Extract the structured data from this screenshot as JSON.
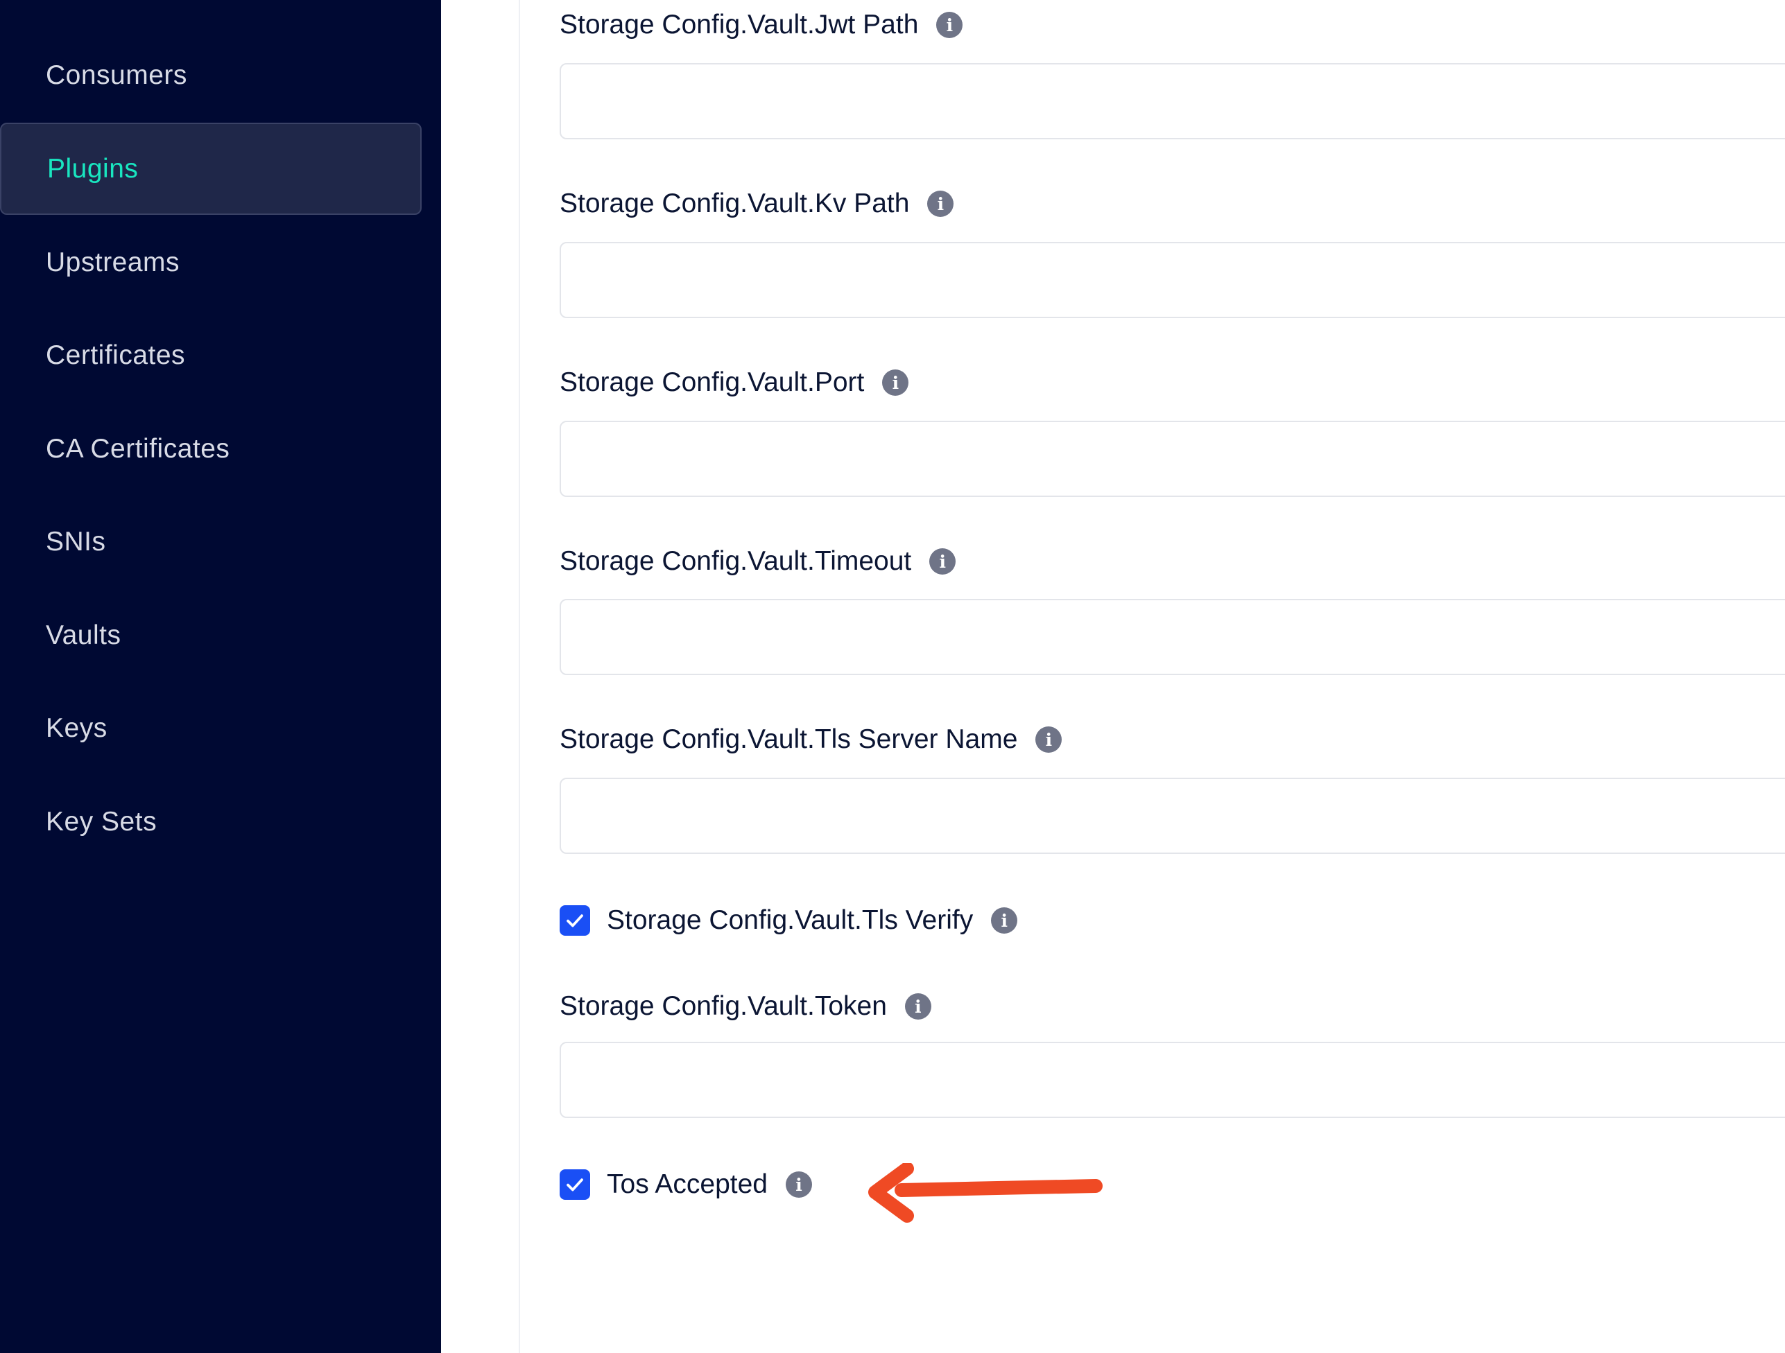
{
  "sidebar": {
    "items": [
      {
        "label": "Consumers",
        "active": false
      },
      {
        "label": "Plugins",
        "active": true
      },
      {
        "label": "Upstreams",
        "active": false
      },
      {
        "label": "Certificates",
        "active": false
      },
      {
        "label": "CA Certificates",
        "active": false
      },
      {
        "label": "SNIs",
        "active": false
      },
      {
        "label": "Vaults",
        "active": false
      },
      {
        "label": "Keys",
        "active": false
      },
      {
        "label": "Key Sets",
        "active": false
      }
    ]
  },
  "form": {
    "jwt_path": {
      "label": "Storage Config.Vault.Jwt Path",
      "value": ""
    },
    "kv_path": {
      "label": "Storage Config.Vault.Kv Path",
      "value": ""
    },
    "port": {
      "label": "Storage Config.Vault.Port",
      "value": ""
    },
    "timeout": {
      "label": "Storage Config.Vault.Timeout",
      "value": ""
    },
    "tls_server_name": {
      "label": "Storage Config.Vault.Tls Server Name",
      "value": ""
    },
    "tls_verify": {
      "label": "Storage Config.Vault.Tls Verify",
      "checked": true
    },
    "token": {
      "label": "Storage Config.Vault.Token",
      "value": ""
    },
    "tos_accepted": {
      "label": "Tos Accepted",
      "checked": true
    }
  },
  "icons": {
    "info": "info-icon",
    "check": "check-icon",
    "annotation": "arrow-left-annotation"
  },
  "colors": {
    "sidebar_bg": "#000933",
    "active_text": "#19e6c0",
    "checkbox": "#1a4ff5",
    "annotation_arrow": "#ef4a24"
  }
}
